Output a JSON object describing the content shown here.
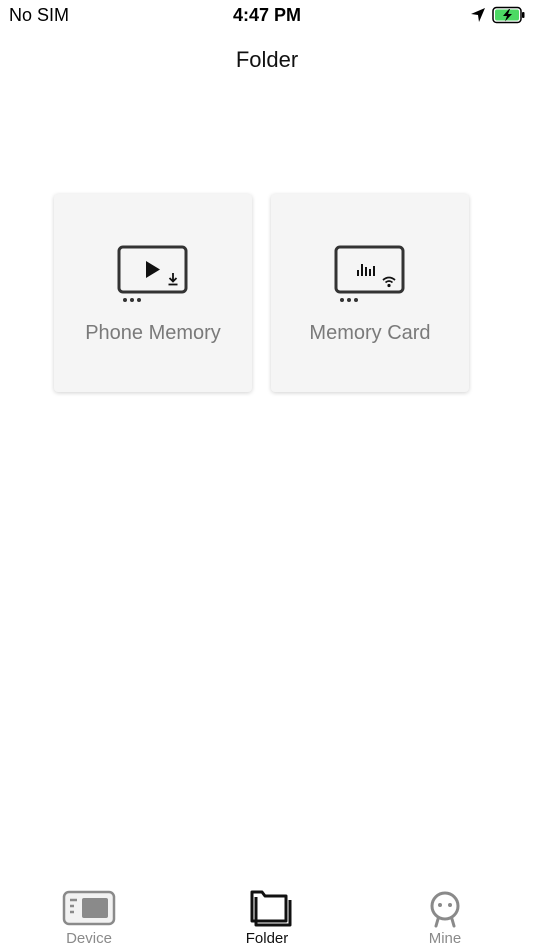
{
  "status_bar": {
    "carrier": "No SIM",
    "time": "4:47 PM",
    "location_icon": "location-arrow-icon",
    "battery_icon": "battery-charging-icon",
    "battery_color": "#4cd964"
  },
  "nav": {
    "title": "Folder"
  },
  "cards": [
    {
      "label": "Phone Memory",
      "icon": "video-download-icon"
    },
    {
      "label": "Memory Card",
      "icon": "audio-wifi-icon"
    }
  ],
  "tabs": [
    {
      "label": "Device",
      "icon": "device-icon",
      "active": false
    },
    {
      "label": "Folder",
      "icon": "folder-icon",
      "active": true
    },
    {
      "label": "Mine",
      "icon": "profile-icon",
      "active": false
    }
  ],
  "colors": {
    "card_background": "#f5f5f5",
    "card_label": "#7a7a7a",
    "tab_active": "#111111",
    "tab_inactive": "#8a8a8a"
  }
}
